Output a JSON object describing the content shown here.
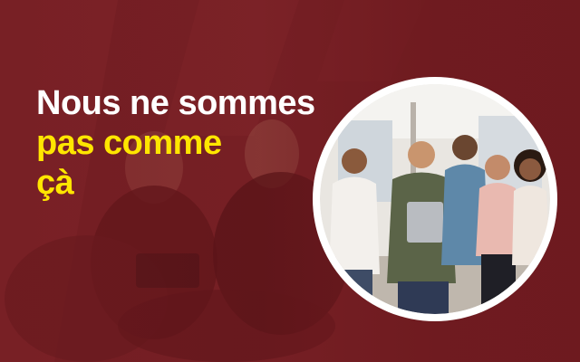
{
  "hero": {
    "headline_line1": "Nous ne sommes",
    "headline_line2": "pas comme",
    "headline_line3": "çà"
  },
  "colors": {
    "background": "#6e1a1f",
    "headline_primary": "#ffffff",
    "headline_accent": "#ffe600"
  },
  "images": {
    "background": "people-seated-meeting-photo",
    "circle": "team-group-photo"
  }
}
